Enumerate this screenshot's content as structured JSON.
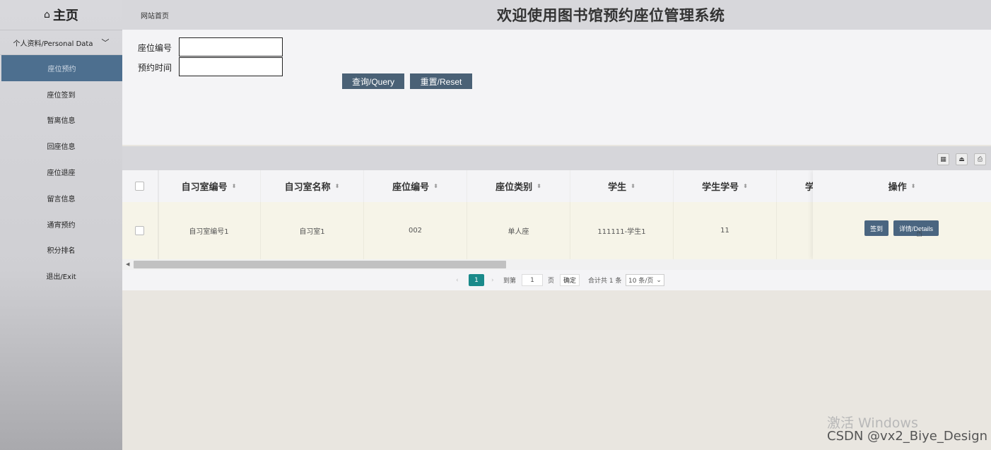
{
  "sidebar": {
    "logo": "主页",
    "home_icon": "⌂",
    "menu_head": "个人资料/Personal Data",
    "menu_head_chevron": "﹀",
    "items": [
      {
        "label": "座位预约",
        "active": true
      },
      {
        "label": "座位签到"
      },
      {
        "label": "暂离信息"
      },
      {
        "label": "回座信息"
      },
      {
        "label": "座位退座"
      },
      {
        "label": "留言信息"
      },
      {
        "label": "通宵预约"
      },
      {
        "label": "积分排名"
      },
      {
        "label": "退出/Exit"
      }
    ]
  },
  "header": {
    "breadcrumb": "网站首页",
    "title": "欢迎使用图书馆预约座位管理系统"
  },
  "search": {
    "seat_no_label": "座位编号",
    "seat_no_value": "",
    "time_label": "预约时间",
    "time_value": "",
    "query_button": "查询/Query",
    "reset_button": "重置/Reset"
  },
  "toolbar": {
    "icons": [
      "columns-icon",
      "export-icon",
      "print-icon"
    ],
    "glyphs": [
      "▦",
      "⏏",
      "⎙"
    ]
  },
  "table": {
    "columns": [
      "自习室编号",
      "自习室名称",
      "座位编号",
      "座位类别",
      "学生",
      "学生学号",
      "学"
    ],
    "sort_glyph": "⬍",
    "rows": [
      [
        "自习室编号1",
        "自习室1",
        "002",
        "单人座",
        "111111-学生1",
        "11"
      ]
    ],
    "ops_header": "操作",
    "ops_buttons": [
      "签到",
      "详情/Details"
    ]
  },
  "pagination": {
    "prev": "‹",
    "current": "1",
    "next": "›",
    "goto_label": "到第",
    "goto_value": "1",
    "page_unit": "页",
    "confirm": "确定",
    "total": "共 1 条",
    "total_prefix": "合计",
    "page_size": "10 条/页",
    "select_arrow": "⌄"
  },
  "watermark": {
    "activate": "激活 Windows",
    "credit": "CSDN @vx2_Biye_Design"
  }
}
